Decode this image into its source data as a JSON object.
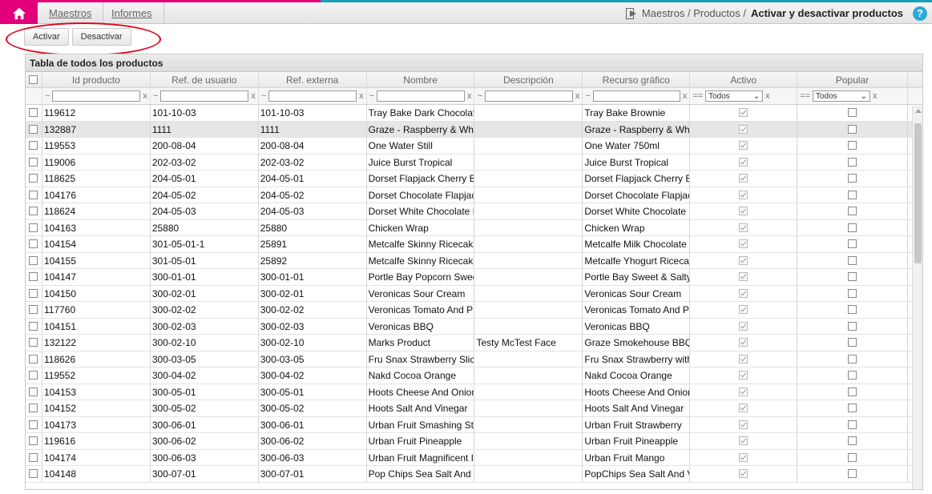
{
  "nav": {
    "menu": [
      "Maestros",
      "Informes"
    ],
    "breadcrumb_path": "Maestros / Productos /",
    "breadcrumb_current": "Activar y desactivar productos",
    "help": "?"
  },
  "toolbar": {
    "activate": "Activar",
    "deactivate": "Desactivar"
  },
  "table": {
    "title": "Tabla de todos los productos",
    "columns": [
      "Id producto",
      "Ref. de usuario",
      "Ref. externa",
      "Nombre",
      "Descripción",
      "Recurso gráfico",
      "Activo",
      "Popular"
    ],
    "filter": {
      "tilde": "~",
      "clear": "x",
      "eq": "==",
      "all": "Todos"
    },
    "rows": [
      {
        "id": "119612",
        "user_ref": "101-10-03",
        "ext_ref": "101-10-03",
        "name": "Tray Bake Dark Chocolate",
        "desc": "",
        "resource": "Tray Bake Brownie",
        "active": true,
        "popular": false
      },
      {
        "id": "132887",
        "user_ref": "1111",
        "ext_ref": "1111",
        "name": "Graze - Raspberry & White",
        "desc": "",
        "resource": "Graze - Raspberry & White",
        "active": true,
        "popular": false
      },
      {
        "id": "119553",
        "user_ref": "200-08-04",
        "ext_ref": "200-08-04",
        "name": "One Water Still",
        "desc": "",
        "resource": "One Water 750ml",
        "active": true,
        "popular": false
      },
      {
        "id": "119006",
        "user_ref": "202-03-02",
        "ext_ref": "202-03-02",
        "name": "Juice Burst Tropical",
        "desc": "",
        "resource": "Juice Burst Tropical",
        "active": true,
        "popular": false
      },
      {
        "id": "118625",
        "user_ref": "204-05-01",
        "ext_ref": "204-05-01",
        "name": "Dorset Flapjack Cherry B",
        "desc": "",
        "resource": "Dorset Flapjack Cherry B",
        "active": true,
        "popular": false
      },
      {
        "id": "104176",
        "user_ref": "204-05-02",
        "ext_ref": "204-05-02",
        "name": "Dorset Chocolate Flapjack",
        "desc": "",
        "resource": "Dorset Chocolate Flapjack",
        "active": true,
        "popular": false
      },
      {
        "id": "118624",
        "user_ref": "204-05-03",
        "ext_ref": "204-05-03",
        "name": "Dorset White Chocolate I",
        "desc": "",
        "resource": "Dorset White Chocolate I",
        "active": true,
        "popular": false
      },
      {
        "id": "104163",
        "user_ref": "25880",
        "ext_ref": "25880",
        "name": "Chicken Wrap",
        "desc": "",
        "resource": "Chicken Wrap",
        "active": true,
        "popular": false
      },
      {
        "id": "104154",
        "user_ref": "301-05-01-1",
        "ext_ref": "25891",
        "name": "Metcalfe Skinny Ricecakes",
        "desc": "",
        "resource": "Metcalfe Milk Chocolate",
        "active": true,
        "popular": false
      },
      {
        "id": "104155",
        "user_ref": "301-05-01",
        "ext_ref": "25892",
        "name": "Metcalfe Skinny Ricecakes",
        "desc": "",
        "resource": "Metcalfe Yhogurt Ricecakes",
        "active": true,
        "popular": false
      },
      {
        "id": "104147",
        "user_ref": "300-01-01",
        "ext_ref": "300-01-01",
        "name": "Portle Bay Popcorn Sweet",
        "desc": "",
        "resource": "Portle Bay Sweet & Salty",
        "active": true,
        "popular": false
      },
      {
        "id": "104150",
        "user_ref": "300-02-01",
        "ext_ref": "300-02-01",
        "name": "Veronicas Sour Cream",
        "desc": "",
        "resource": "Veronicas Sour Cream",
        "active": true,
        "popular": false
      },
      {
        "id": "117760",
        "user_ref": "300-02-02",
        "ext_ref": "300-02-02",
        "name": "Veronicas Tomato And P",
        "desc": "",
        "resource": "Veronicas Tomato And P",
        "active": true,
        "popular": false
      },
      {
        "id": "104151",
        "user_ref": "300-02-03",
        "ext_ref": "300-02-03",
        "name": "Veronicas BBQ",
        "desc": "",
        "resource": "Veronicas BBQ",
        "active": true,
        "popular": false
      },
      {
        "id": "132122",
        "user_ref": "300-02-10",
        "ext_ref": "300-02-10",
        "name": "Marks Product",
        "desc": "Testy McTest Face",
        "resource": "Graze Smokehouse BBQ",
        "active": true,
        "popular": false
      },
      {
        "id": "118626",
        "user_ref": "300-03-05",
        "ext_ref": "300-03-05",
        "name": "Fru Snax Strawberry Slices",
        "desc": "",
        "resource": "Fru Snax Strawberry with",
        "active": true,
        "popular": false
      },
      {
        "id": "119552",
        "user_ref": "300-04-02",
        "ext_ref": "300-04-02",
        "name": "Nakd Cocoa Orange",
        "desc": "",
        "resource": "Nakd Cocoa Orange",
        "active": true,
        "popular": false
      },
      {
        "id": "104153",
        "user_ref": "300-05-01",
        "ext_ref": "300-05-01",
        "name": "Hoots Cheese And Onion",
        "desc": "",
        "resource": "Hoots Cheese And Onion",
        "active": true,
        "popular": false
      },
      {
        "id": "104152",
        "user_ref": "300-05-02",
        "ext_ref": "300-05-02",
        "name": "Hoots Salt And Vinegar",
        "desc": "",
        "resource": "Hoots Salt And Vinegar",
        "active": true,
        "popular": false
      },
      {
        "id": "104173",
        "user_ref": "300-06-01",
        "ext_ref": "300-06-01",
        "name": "Urban Fruit Smashing St",
        "desc": "",
        "resource": "Urban Fruit Strawberry",
        "active": true,
        "popular": false
      },
      {
        "id": "119616",
        "user_ref": "300-06-02",
        "ext_ref": "300-06-02",
        "name": "Urban Fruit Pineapple",
        "desc": "",
        "resource": "Urban Fruit Pineapple",
        "active": true,
        "popular": false
      },
      {
        "id": "104174",
        "user_ref": "300-06-03",
        "ext_ref": "300-06-03",
        "name": "Urban Fruit Magnificent I",
        "desc": "",
        "resource": "Urban Fruit Mango",
        "active": true,
        "popular": false
      },
      {
        "id": "104148",
        "user_ref": "300-07-01",
        "ext_ref": "300-07-01",
        "name": "Pop Chips Sea Salt And V",
        "desc": "",
        "resource": "PopChips Sea Salt And V",
        "active": true,
        "popular": false
      }
    ]
  }
}
